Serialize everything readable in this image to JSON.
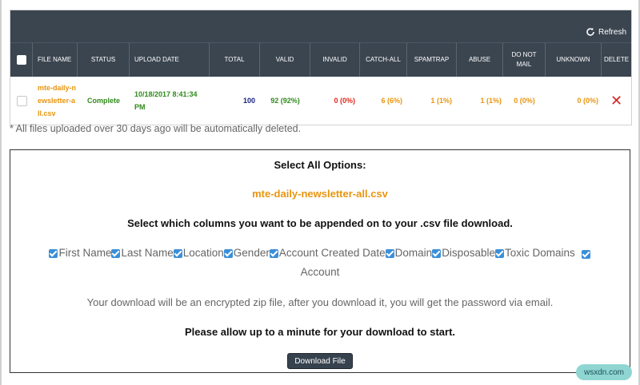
{
  "toolbar": {
    "refresh_label": "Refresh"
  },
  "table": {
    "columns": [
      "FILE NAME",
      "STATUS",
      "UPLOAD DATE",
      "TOTAL",
      "VALID",
      "INVALID",
      "CATCH-ALL",
      "SPAMTRAP",
      "ABUSE",
      "DO NOT MAIL",
      "UNKNOWN",
      "DELETE"
    ],
    "row": {
      "file_name": "mte-daily-newsletter-all.csv",
      "status": "Complete",
      "upload_date": "10/18/2017 8:41:34 PM",
      "total": "100",
      "valid": "92 (92%)",
      "invalid": "0 (0%)",
      "catch_all": "6 (6%)",
      "spamtrap": "1 (1%)",
      "abuse": "1 (1%)",
      "do_not_mail": "0 (0%)",
      "unknown": "0 (0%)"
    }
  },
  "note": "* All files uploaded over 30 days ago will be automatically deleted.",
  "options": {
    "title": "Select All Options:",
    "file_name": "mte-daily-newsletter-all.csv",
    "instruction": "Select which columns you want to be appended on to your .csv file download.",
    "checkboxes": [
      "First Name",
      "Last Name",
      "Location",
      "Gender",
      "Account Created Date",
      "Domain",
      "Disposable",
      "Toxic Domains",
      "Account"
    ],
    "encryption_note": "Your download will be an encrypted zip file, after you download it, you will get the password via email.",
    "wait_note": "Please allow up to a minute for your download to start.",
    "download_label": "Download File"
  },
  "watermark": "wsxdn.com",
  "colors": {
    "header_bg": "#3b4550",
    "accent_orange": "#e8950f",
    "valid_green": "#2f8a1a",
    "invalid_red": "#e0281b",
    "checkbox_blue": "#3b8fd9"
  }
}
